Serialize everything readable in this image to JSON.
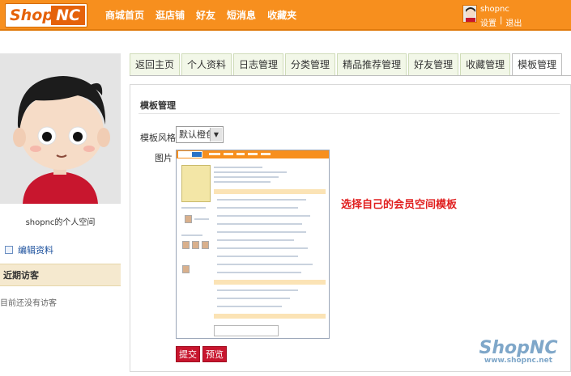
{
  "header": {
    "logo": {
      "shop": "Shop",
      "nc": "NC"
    },
    "nav": [
      "商城首页",
      "逛店铺",
      "好友",
      "短消息",
      "收藏夹"
    ],
    "user": {
      "name": "shopnc",
      "links": [
        "设置",
        "|",
        "退出"
      ]
    }
  },
  "sidebar": {
    "space_name": "shopnc的个人空间",
    "edit_profile": "编辑资料",
    "recent_visitors_title": "近期访客",
    "no_visitors": "目前还没有访客"
  },
  "tabs": [
    "返回主页",
    "个人资料",
    "日志管理",
    "分类管理",
    "精品推荐管理",
    "好友管理",
    "收藏管理",
    "模板管理"
  ],
  "active_tab": "模板管理",
  "panel": {
    "title": "模板管理",
    "style_label": "模板风格",
    "style_value": "默认橙色",
    "picture_label": "图片",
    "hint": "选择自己的会员空间模板",
    "submit_label": "提交",
    "preview_label": "预览"
  },
  "watermark": {
    "title": "ShopNC",
    "url": "www.shopnc.net"
  },
  "colors": {
    "header_orange": "#f78f1e",
    "button_red": "#c8162e",
    "hint_red": "#e01d1d",
    "tab_green_bg": "#f2f7e8"
  }
}
